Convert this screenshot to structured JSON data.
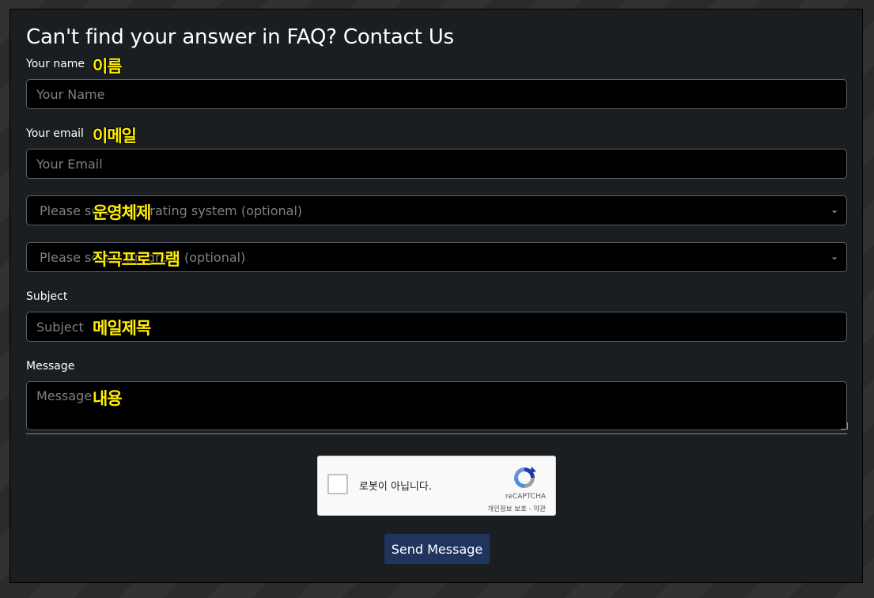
{
  "form": {
    "title": "Can't find your answer in FAQ? Contact Us",
    "name_label": "Your name",
    "name_placeholder": "Your Name",
    "email_label": "Your email",
    "email_placeholder": "Your Email",
    "os_select_text": "Please select operating system (optional)",
    "program_select_text": "Please select program (optional)",
    "subject_label": "Subject",
    "subject_placeholder": "Subject",
    "message_label": "Message",
    "message_placeholder": "Message",
    "send_label": "Send Message"
  },
  "annotations": {
    "name": "이름",
    "email": "이메일",
    "os": "운영체제",
    "program": "작곡프로그램",
    "subject": "메일제목",
    "message": "내용"
  },
  "captcha": {
    "checkbox_text": "로봇이 아닙니다.",
    "brand": "reCAPTCHA",
    "links": "개인정보 보호 - 약관"
  },
  "colors": {
    "panel_bg": "#1b1e20",
    "field_bg": "#000000",
    "annotation": "#ffee00",
    "button_bg": "#1f355e"
  }
}
